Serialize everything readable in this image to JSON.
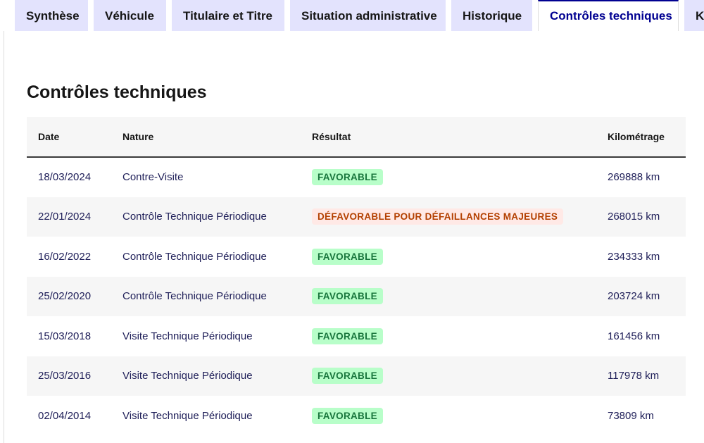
{
  "tabs": [
    {
      "label": "Synthèse",
      "active": false
    },
    {
      "label": "Véhicule",
      "active": false
    },
    {
      "label": "Titulaire et Titre",
      "active": false
    },
    {
      "label": "Situation administrative",
      "active": false
    },
    {
      "label": "Historique",
      "active": false
    },
    {
      "label": "Contrôles techniques",
      "active": true
    },
    {
      "label": "Ki",
      "active": false
    }
  ],
  "section": {
    "title": "Contrôles techniques"
  },
  "table": {
    "headers": {
      "date": "Date",
      "nature": "Nature",
      "result": "Résultat",
      "mileage": "Kilométrage"
    },
    "rows": [
      {
        "date": "18/03/2024",
        "nature": "Contre-Visite",
        "result": "FAVORABLE",
        "status": "ok",
        "mileage": "269888 km"
      },
      {
        "date": "22/01/2024",
        "nature": "Contrôle Technique Périodique",
        "result": "DÉFAVORABLE POUR DÉFAILLANCES MAJEURES",
        "status": "ko",
        "mileage": "268015 km"
      },
      {
        "date": "16/02/2022",
        "nature": "Contrôle Technique Périodique",
        "result": "FAVORABLE",
        "status": "ok",
        "mileage": "234333 km"
      },
      {
        "date": "25/02/2020",
        "nature": "Contrôle Technique Périodique",
        "result": "FAVORABLE",
        "status": "ok",
        "mileage": "203724 km"
      },
      {
        "date": "15/03/2018",
        "nature": "Visite Technique Périodique",
        "result": "FAVORABLE",
        "status": "ok",
        "mileage": "161456 km"
      },
      {
        "date": "25/03/2016",
        "nature": "Visite Technique Périodique",
        "result": "FAVORABLE",
        "status": "ok",
        "mileage": "117978 km"
      },
      {
        "date": "02/04/2014",
        "nature": "Visite Technique Périodique",
        "result": "FAVORABLE",
        "status": "ok",
        "mileage": "73809 km"
      }
    ]
  },
  "colors": {
    "accent": "#000091",
    "tab_background": "#e3e3fd",
    "row_stripe": "#f6f6f6",
    "favorable_bg": "#b8fec9",
    "favorable_text": "#18753c",
    "unfavorable_bg": "#ffe9e6",
    "unfavorable_text": "#b34000"
  }
}
